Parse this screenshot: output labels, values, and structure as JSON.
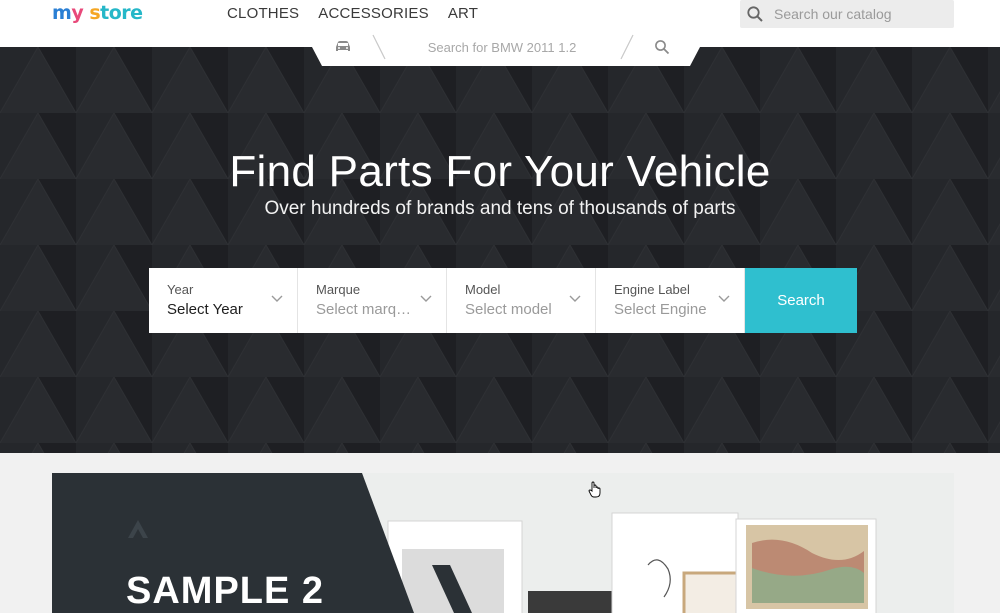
{
  "header": {
    "logo_parts": [
      "m",
      "y ",
      "s",
      "tore"
    ],
    "nav": [
      "CLOTHES",
      "ACCESSORIES",
      "ART"
    ],
    "catalog_search_placeholder": "Search our catalog"
  },
  "vehicle_search": {
    "placeholder": "Search for BMW 2011 1.2"
  },
  "hero": {
    "title": "Find Parts For Your Vehicle",
    "subtitle": "Over hundreds of brands and tens of thousands of parts",
    "fields": [
      {
        "label": "Year",
        "value": "Select Year",
        "active": true
      },
      {
        "label": "Marque",
        "value": "Select marque",
        "active": false
      },
      {
        "label": "Model",
        "value": "Select model",
        "active": false
      },
      {
        "label": "Engine Label",
        "value": "Select Engine",
        "active": false
      }
    ],
    "search_button": "Search"
  },
  "banner": {
    "title": "SAMPLE 2"
  },
  "colors": {
    "accent": "#2fbfcf",
    "hero_bg": "#26282b",
    "banner_dark": "#2b3136"
  }
}
